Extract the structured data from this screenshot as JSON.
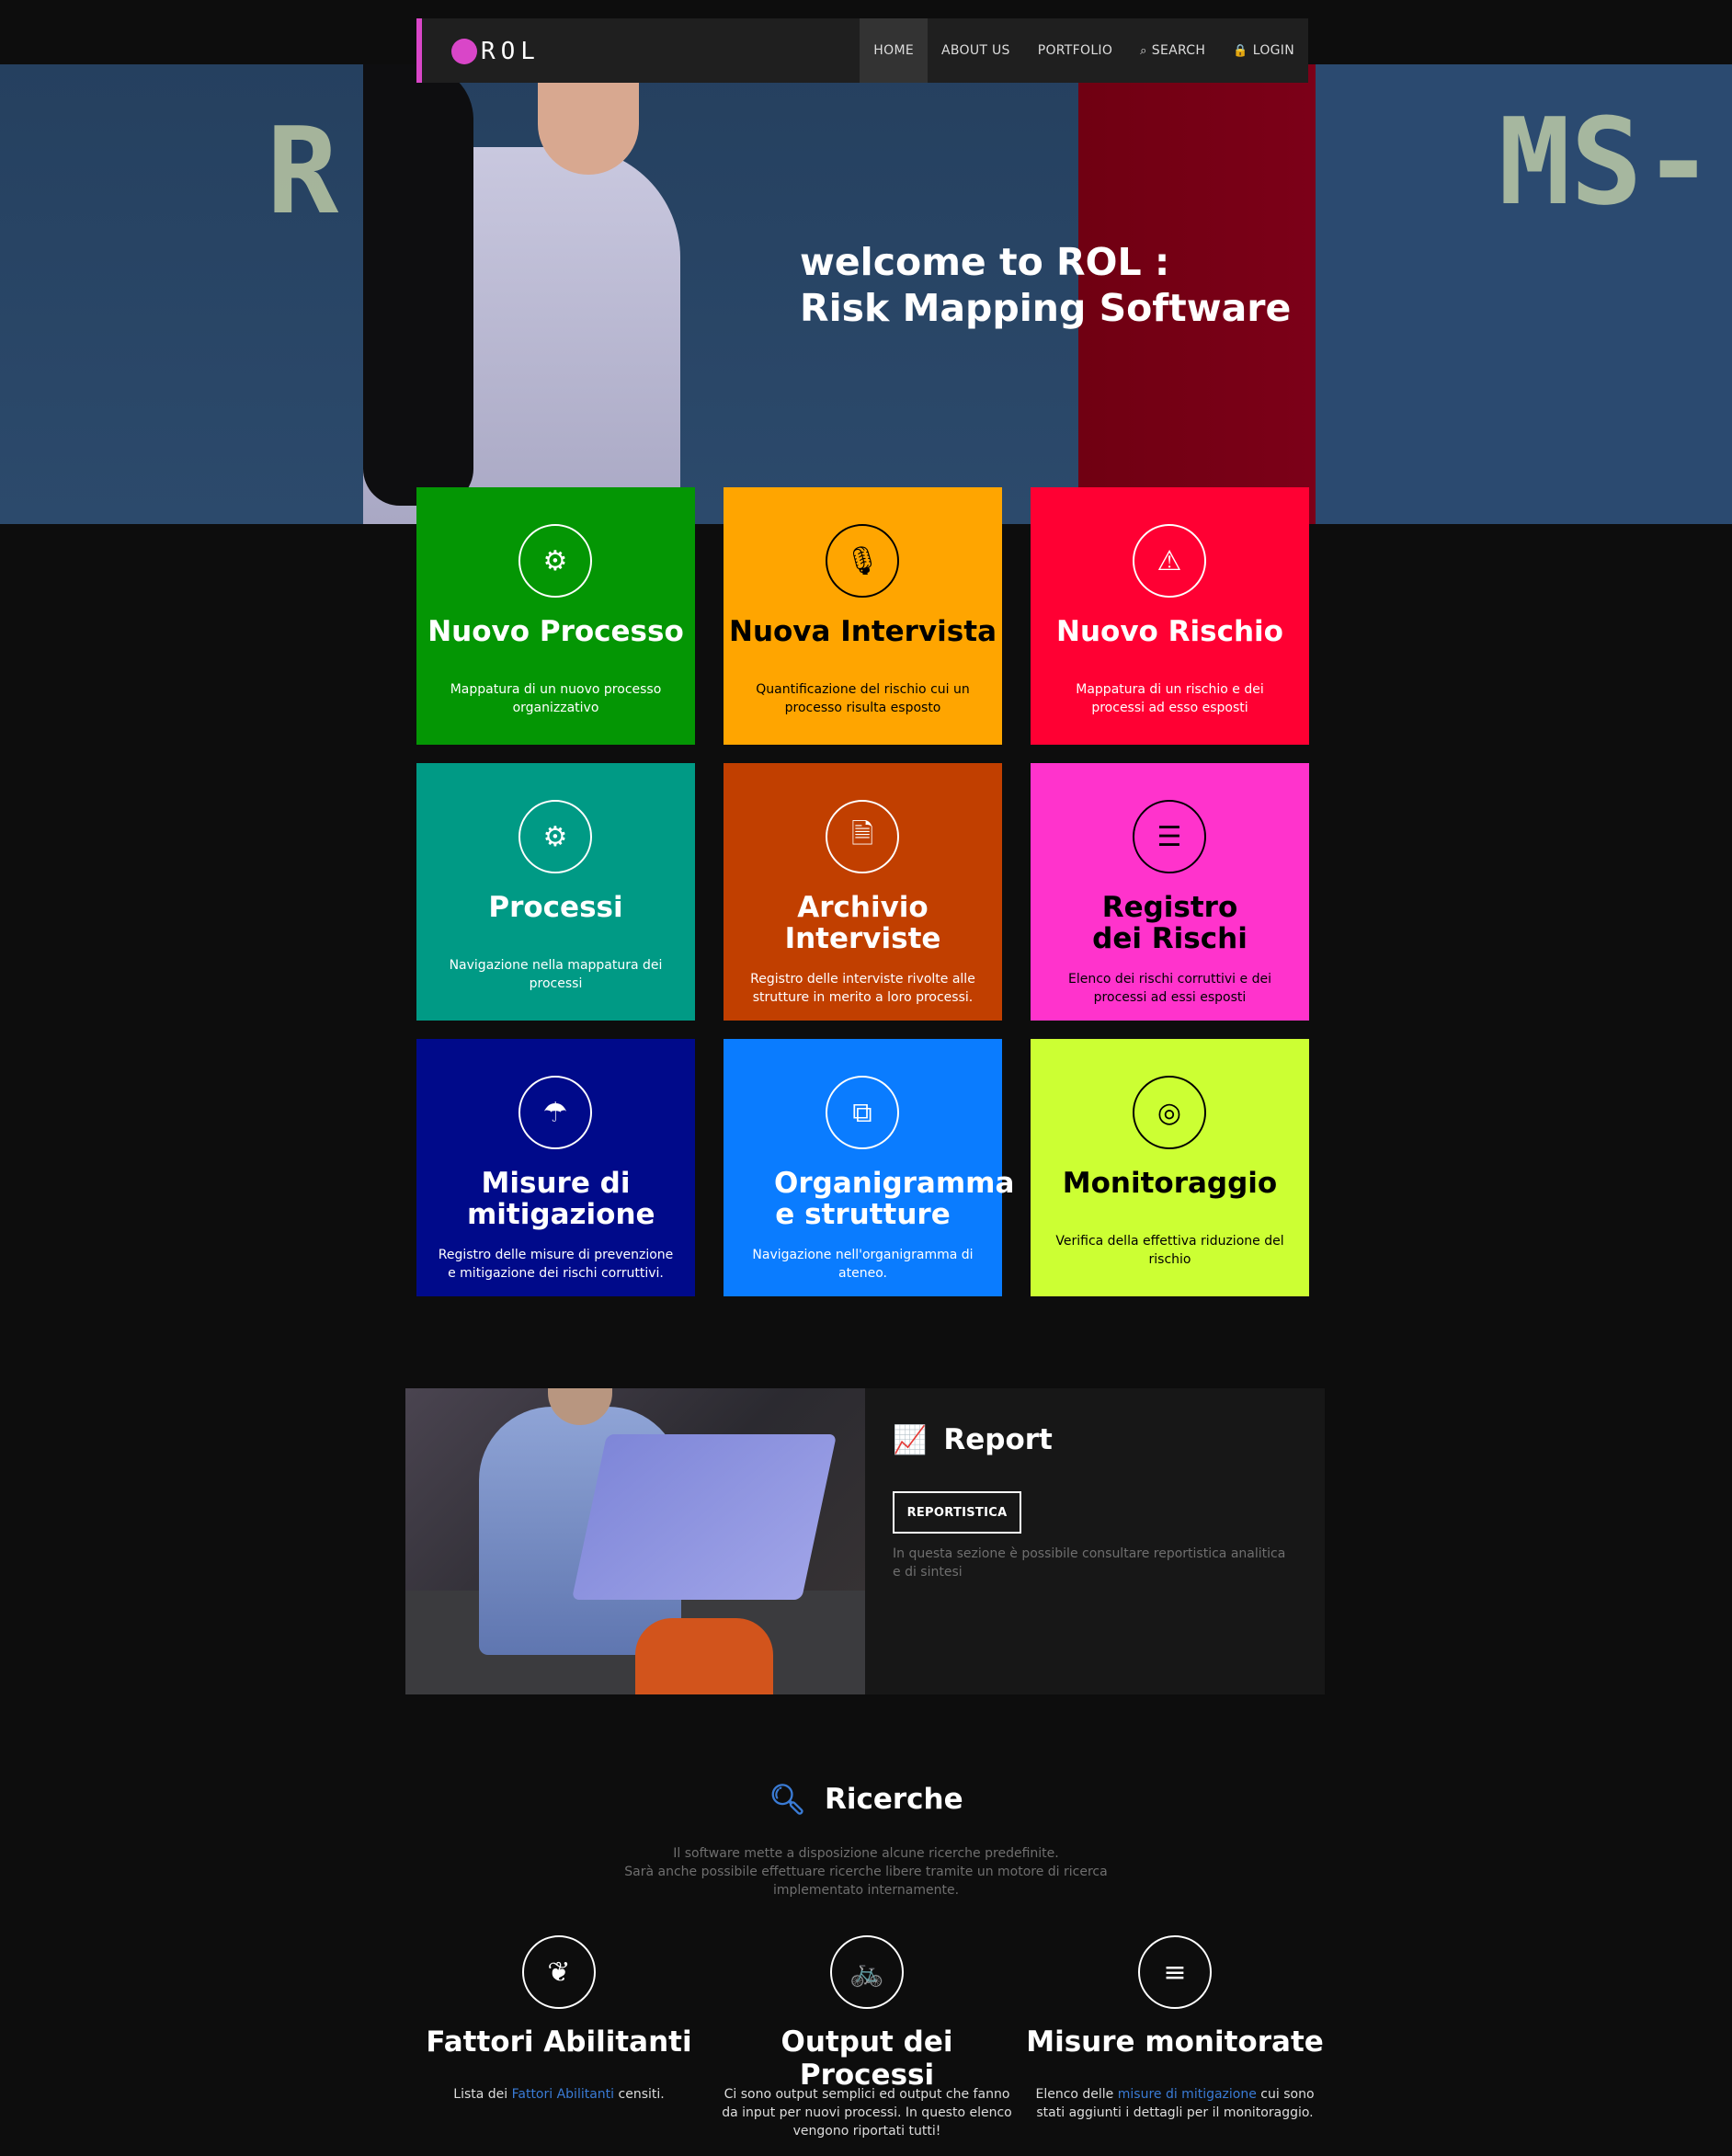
{
  "nav": {
    "logo_text": "ROL",
    "items": [
      {
        "label": "HOME",
        "icon": ""
      },
      {
        "label": "ABOUT US",
        "icon": ""
      },
      {
        "label": "PORTFOLIO",
        "icon": ""
      },
      {
        "label": "SEARCH",
        "icon": "search-icon"
      },
      {
        "label": "LOGIN",
        "icon": "lock-icon"
      }
    ],
    "active_index": 0
  },
  "hero": {
    "chalk_left": "R  S",
    "chalk_right": "MS-",
    "title_line1": "welcome to ROL :",
    "title_line2": "Risk Mapping Software"
  },
  "tiles": [
    {
      "title": "Nuovo Processo",
      "desc": "Mappatura di un nuovo processo organizzativo",
      "icon": "gear-icon",
      "glyph": "⚙",
      "bg": "#049604",
      "fg": "#ffffff"
    },
    {
      "title": "Nuova Intervista",
      "desc": "Quantificazione del rischio cui un processo risulta esposto",
      "icon": "microphone-icon",
      "glyph": "🎙",
      "bg": "#ffa500",
      "fg": "#000000"
    },
    {
      "title": "Nuovo Rischio",
      "desc": "Mappatura di un rischio e dei processi ad esso esposti",
      "icon": "warning-icon",
      "glyph": "⚠",
      "bg": "#ff0033",
      "fg": "#ffffff"
    },
    {
      "title": "Processi",
      "desc": "Navigazione nella mappatura dei processi",
      "icon": "gears-icon",
      "glyph": "⚙",
      "bg": "#009a85",
      "fg": "#ffffff"
    },
    {
      "title": "Archivio Interviste",
      "desc": "Registro delle interviste rivolte alle strutture in merito a loro processi.",
      "icon": "audio-file-icon",
      "glyph": "🗎",
      "bg": "#c13f00",
      "fg": "#ffffff"
    },
    {
      "title": "Registro dei Rischi",
      "desc": "Elenco dei rischi corruttivi e dei processi ad essi esposti",
      "icon": "server-icon",
      "glyph": "☰",
      "bg": "#ff33cc",
      "fg": "#000000"
    },
    {
      "title": "Misure di mitigazione",
      "desc": "Registro delle misure di prevenzione e mitigazione dei rischi corruttivi.",
      "icon": "umbrella-icon",
      "glyph": "☂",
      "bg": "#000a8a",
      "fg": "#ffffff"
    },
    {
      "title": "Organigramma e strutture",
      "desc": "Navigazione nell'organigramma di ateneo.",
      "icon": "sitemap-icon",
      "glyph": "⧉",
      "bg": "#0a7cff",
      "fg": "#ffffff"
    },
    {
      "title": "Monitoraggio",
      "desc": "Verifica della effettiva riduzione del rischio",
      "icon": "target-icon",
      "glyph": "◎",
      "bg": "#ccff33",
      "fg": "#000000"
    }
  ],
  "report": {
    "title": "Report",
    "icon": "line-chart-icon",
    "button_label": "REPORTISTICA",
    "desc": "In questa sezione è possibile consultare reportistica analitica e di sintesi"
  },
  "ricerche": {
    "title": "Ricerche",
    "icon": "search-icon",
    "line1": "Il software mette a disposizione alcune ricerche predefinite.",
    "line2": "Sarà anche possibile effettuare ricerche libere tramite un motore di ricerca",
    "line3": "implementato internamente.",
    "features": [
      {
        "title": "Fattori Abilitanti",
        "icon": "leaf-icon",
        "glyph": "❦",
        "desc_pre": "Lista dei ",
        "desc_link": "Fattori Abilitanti",
        "desc_post": " censiti."
      },
      {
        "title": "Output dei Processi",
        "icon": "bicycle-icon",
        "glyph": "🚲",
        "desc_pre": "Ci sono output semplici ed output che fanno da input per nuovi processi. In questo elenco vengono riportati tutti!",
        "desc_link": "",
        "desc_post": ""
      },
      {
        "title": "Misure monitorate",
        "icon": "list-icon",
        "glyph": "≡",
        "desc_pre": "Elenco delle ",
        "desc_link": "misure di mitigazione",
        "desc_post": " cui sono stati aggiunti i dettagli per il monitoraggio."
      }
    ]
  }
}
